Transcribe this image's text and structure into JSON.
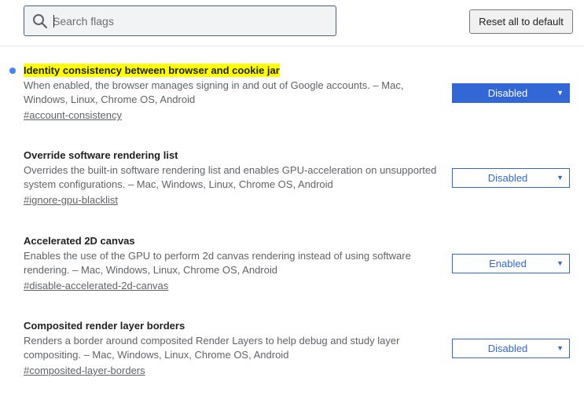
{
  "search": {
    "placeholder": "Search flags",
    "value": ""
  },
  "header": {
    "reset_label": "Reset all to default"
  },
  "icons": {
    "search": "search-icon",
    "dropdown": "chevron-down-icon",
    "modified": "dot-icon"
  },
  "colors": {
    "accent": "#3367d6",
    "highlight": "#ffff00",
    "modified_dot": "#4285f4"
  },
  "flags": [
    {
      "title": "Identity consistency between browser and cookie jar",
      "description": "When enabled, the browser manages signing in and out of Google accounts. – Mac, Windows, Linux, Chrome OS, Android",
      "link": "#account-consistency",
      "value": "Disabled",
      "highlighted": true,
      "modified": true
    },
    {
      "title": "Override software rendering list",
      "description": "Overrides the built-in software rendering list and enables GPU-acceleration on unsupported system configurations. – Mac, Windows, Linux, Chrome OS, Android",
      "link": "#ignore-gpu-blacklist",
      "value": "Disabled",
      "highlighted": false,
      "modified": false
    },
    {
      "title": "Accelerated 2D canvas",
      "description": "Enables the use of the GPU to perform 2d canvas rendering instead of using software rendering. – Mac, Windows, Linux, Chrome OS, Android",
      "link": "#disable-accelerated-2d-canvas",
      "value": "Enabled",
      "highlighted": false,
      "modified": false
    },
    {
      "title": "Composited render layer borders",
      "description": "Renders a border around composited Render Layers to help debug and study layer compositing. – Mac, Windows, Linux, Chrome OS, Android",
      "link": "#composited-layer-borders",
      "value": "Disabled",
      "highlighted": false,
      "modified": false
    }
  ]
}
